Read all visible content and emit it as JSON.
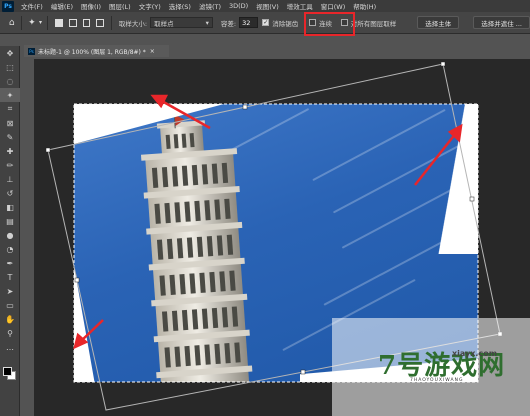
{
  "menubar": {
    "logo": "Ps",
    "items": [
      "文件(F)",
      "编辑(E)",
      "图像(I)",
      "图层(L)",
      "文字(Y)",
      "选择(S)",
      "滤镜(T)",
      "3D(D)",
      "视图(V)",
      "增效工具",
      "窗口(W)",
      "帮助(H)"
    ]
  },
  "options": {
    "sample_size_label": "取样大小:",
    "sample_size_value": "取样点",
    "tolerance_label": "容差:",
    "tolerance_value": "32",
    "antialias_label": "消除锯齿",
    "contiguous_label": "连续",
    "sample_all_label": "对所有图层取样",
    "select_subject_label": "选择主体",
    "select_mask_label": "选择并遮住 ..."
  },
  "document": {
    "tab_title": "未标题-1 @ 100% (图层 1, RGB/8#) *"
  },
  "watermark": {
    "brand": "7号游戏网",
    "url": "xiayx.com",
    "sub": "7HAOYOUXIWANG"
  },
  "colors": {
    "highlight": "#e8262a",
    "arrow": "#e8262a",
    "sky": "#2a63b5"
  },
  "tools": [
    "move-icon",
    "marquee-icon",
    "lasso-icon",
    "magic-wand-icon",
    "crop-icon",
    "frame-icon",
    "eyedropper-icon",
    "healing-icon",
    "brush-icon",
    "stamp-icon",
    "history-brush-icon",
    "eraser-icon",
    "gradient-icon",
    "blur-icon",
    "dodge-icon",
    "pen-icon",
    "type-icon",
    "path-select-icon",
    "rectangle-icon",
    "hand-icon",
    "zoom-icon",
    "more-icon"
  ]
}
